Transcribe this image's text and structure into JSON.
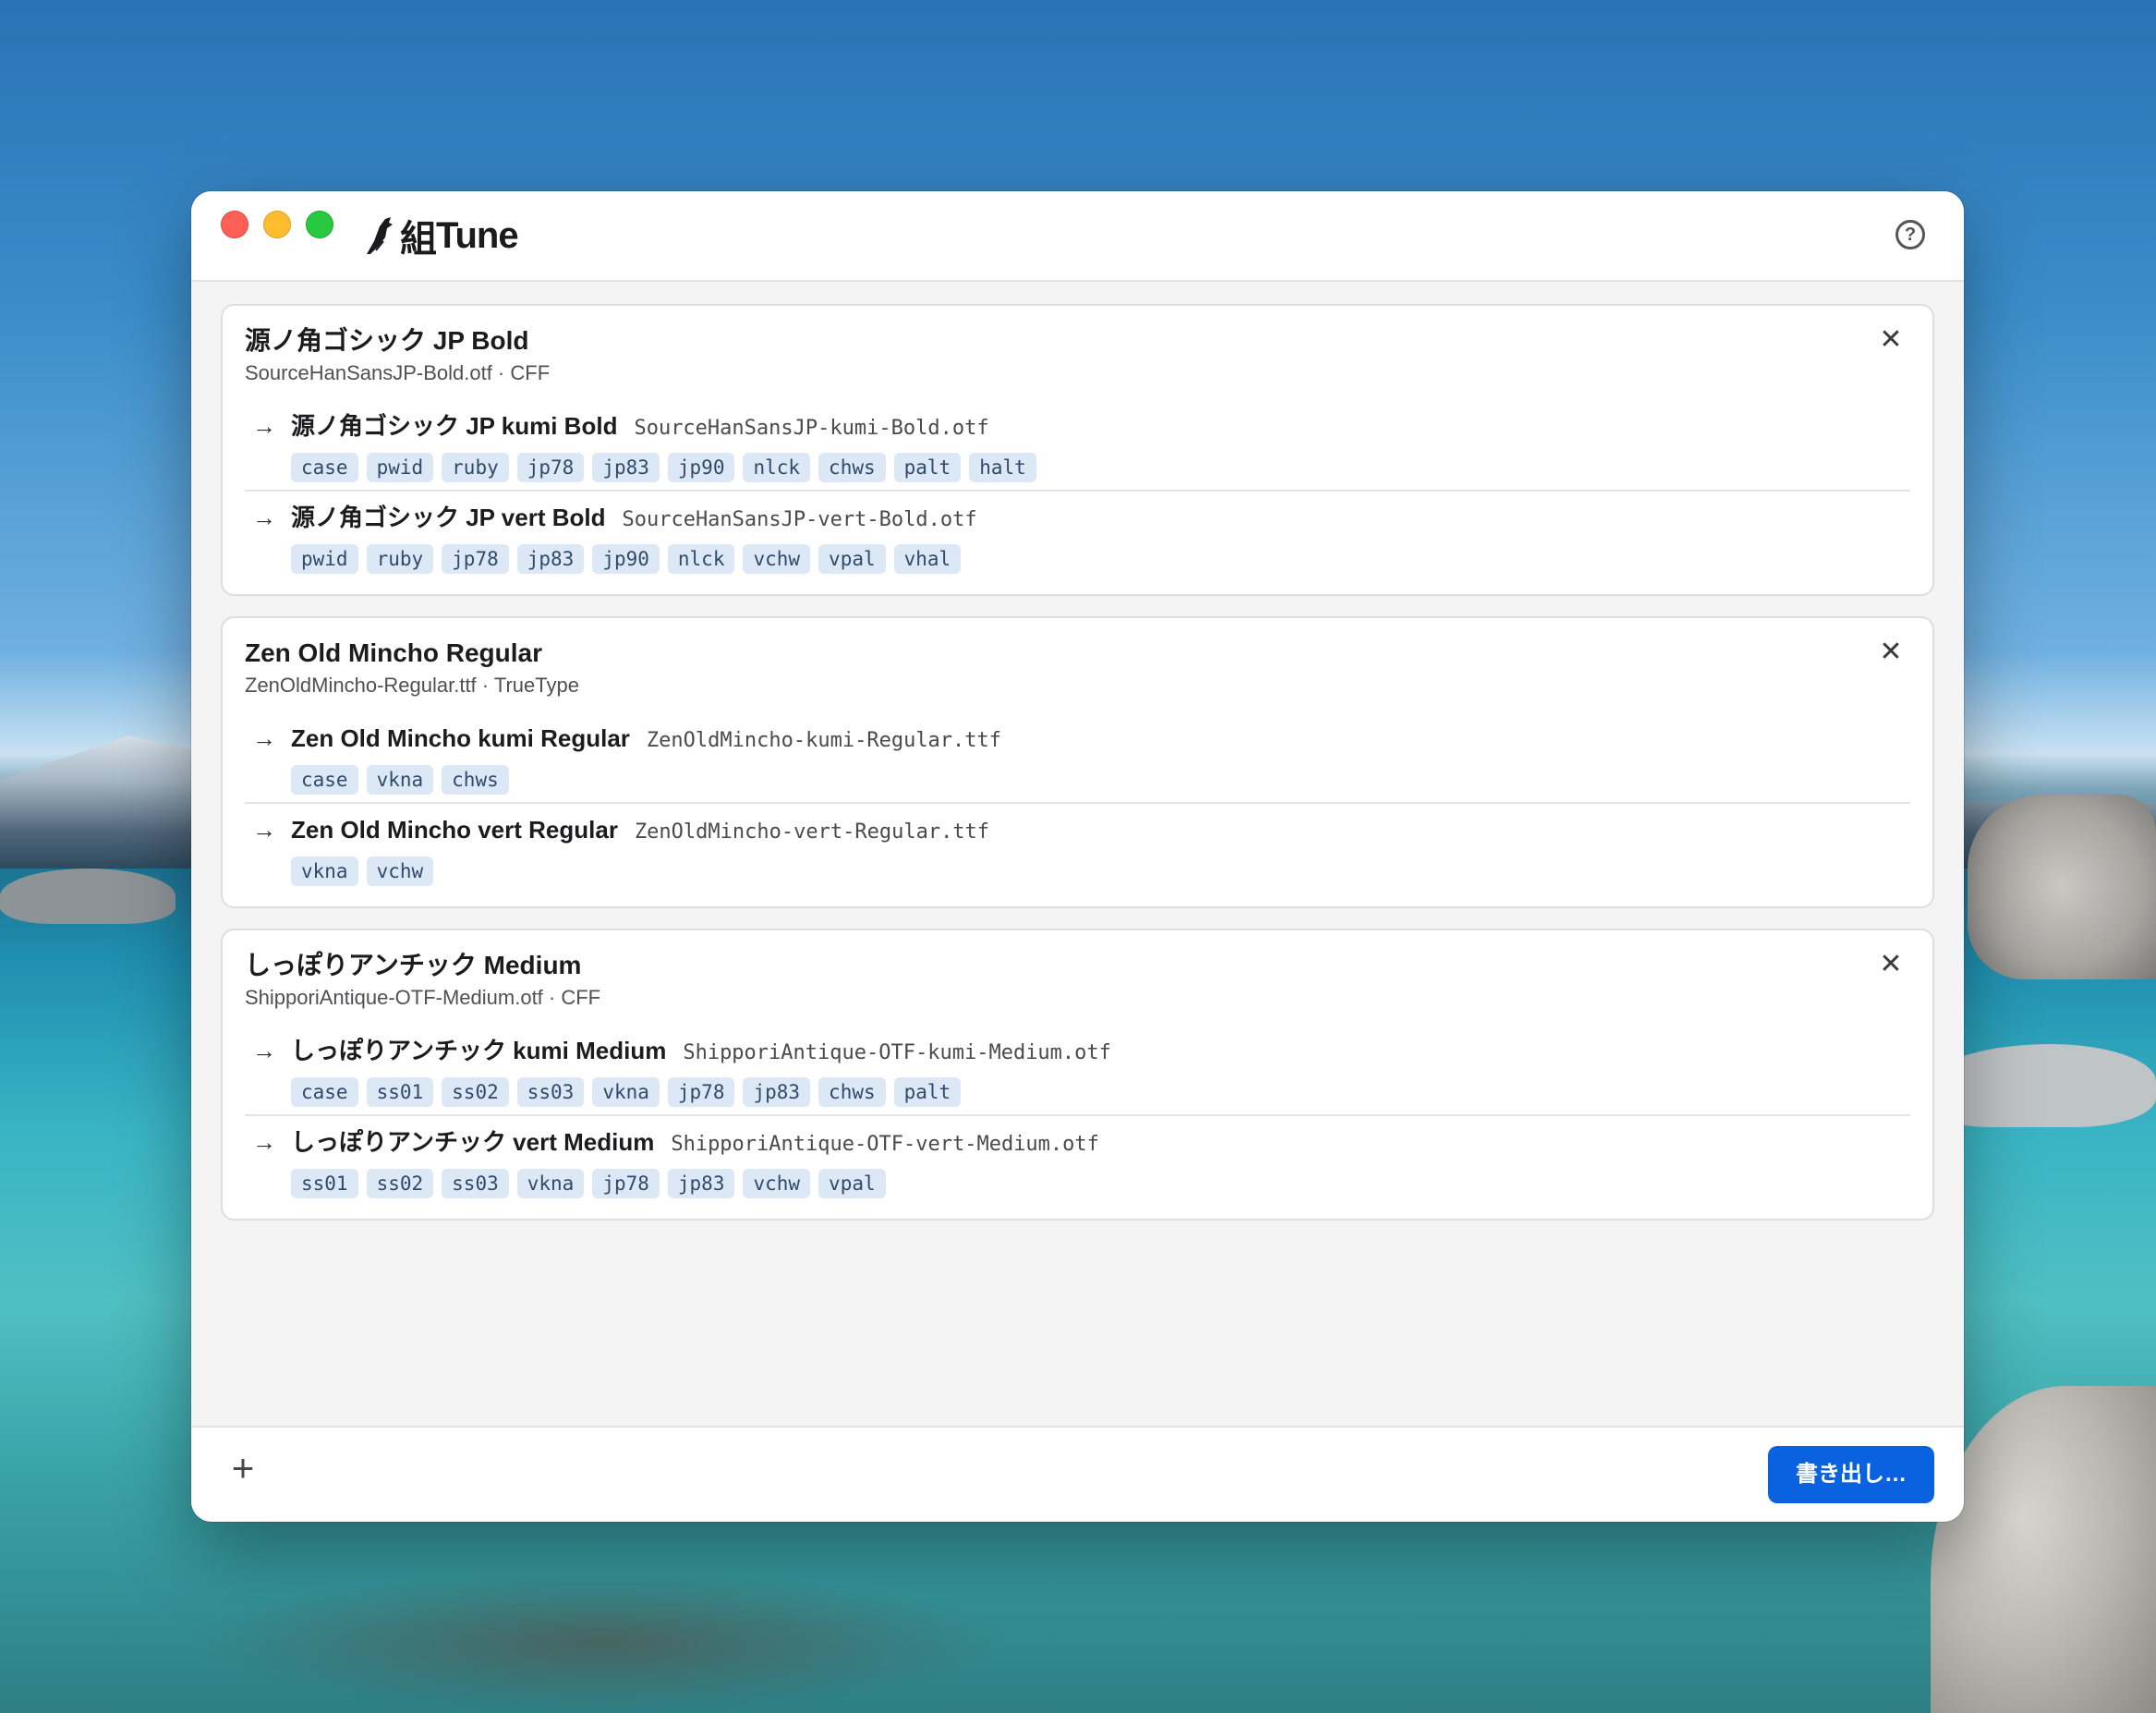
{
  "app": {
    "name": "Tune",
    "logo_char": "組"
  },
  "fonts": [
    {
      "title": "源ノ角ゴシック JP Bold",
      "subtitle": "SourceHanSansJP-Bold.otf · CFF",
      "outputs": [
        {
          "name": "源ノ角ゴシック JP kumi Bold",
          "file": "SourceHanSansJP-kumi-Bold.otf",
          "tags": [
            "case",
            "pwid",
            "ruby",
            "jp78",
            "jp83",
            "jp90",
            "nlck",
            "chws",
            "palt",
            "halt"
          ]
        },
        {
          "name": "源ノ角ゴシック JP vert Bold",
          "file": "SourceHanSansJP-vert-Bold.otf",
          "tags": [
            "pwid",
            "ruby",
            "jp78",
            "jp83",
            "jp90",
            "nlck",
            "vchw",
            "vpal",
            "vhal"
          ]
        }
      ]
    },
    {
      "title": "Zen Old Mincho Regular",
      "subtitle": "ZenOldMincho-Regular.ttf · TrueType",
      "outputs": [
        {
          "name": "Zen Old Mincho kumi Regular",
          "file": "ZenOldMincho-kumi-Regular.ttf",
          "tags": [
            "case",
            "vkna",
            "chws"
          ]
        },
        {
          "name": "Zen Old Mincho vert Regular",
          "file": "ZenOldMincho-vert-Regular.ttf",
          "tags": [
            "vkna",
            "vchw"
          ]
        }
      ]
    },
    {
      "title": "しっぽりアンチック Medium",
      "subtitle": "ShipporiAntique-OTF-Medium.otf · CFF",
      "outputs": [
        {
          "name": "しっぽりアンチック kumi Medium",
          "file": "ShipporiAntique-OTF-kumi-Medium.otf",
          "tags": [
            "case",
            "ss01",
            "ss02",
            "ss03",
            "vkna",
            "jp78",
            "jp83",
            "chws",
            "palt"
          ]
        },
        {
          "name": "しっぽりアンチック vert Medium",
          "file": "ShipporiAntique-OTF-vert-Medium.otf",
          "tags": [
            "ss01",
            "ss02",
            "ss03",
            "vkna",
            "jp78",
            "jp83",
            "vchw",
            "vpal"
          ]
        }
      ]
    }
  ],
  "footer": {
    "add_label": "+",
    "export_label": "書き出し…"
  },
  "icons": {
    "help": "?",
    "close": "✕",
    "arrow": "→"
  },
  "colors": {
    "accent": "#0b62e0",
    "tag_bg": "#dde8f6",
    "tag_text": "#2f4a6b"
  }
}
